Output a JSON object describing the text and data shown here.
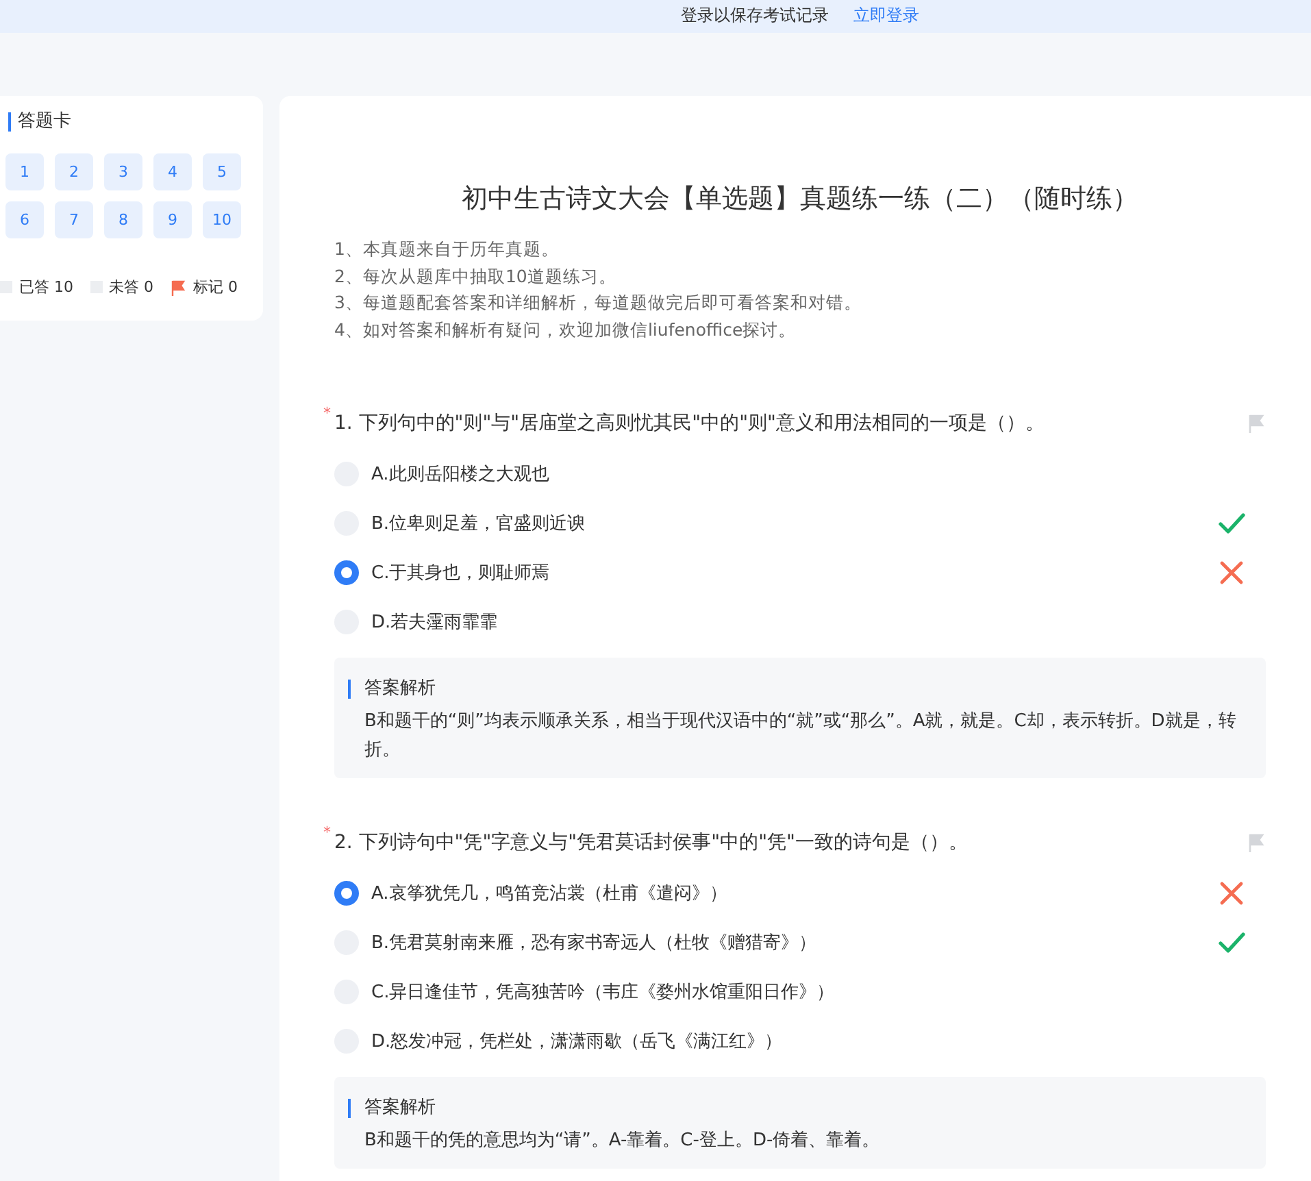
{
  "top_bar": {
    "message": "登录以保存考试记录",
    "login_link": "立即登录"
  },
  "answer_card": {
    "title": "答题卡",
    "numbers": [
      {
        "label": "1",
        "answered": true
      },
      {
        "label": "2",
        "answered": true
      },
      {
        "label": "3",
        "answered": true
      },
      {
        "label": "4",
        "answered": true
      },
      {
        "label": "5",
        "answered": true
      },
      {
        "label": "6",
        "answered": true
      },
      {
        "label": "7",
        "answered": true
      },
      {
        "label": "8",
        "answered": true
      },
      {
        "label": "9",
        "answered": true
      },
      {
        "label": "10",
        "answered": true
      }
    ],
    "legend": [
      {
        "kind": "answered",
        "label": "已答 10"
      },
      {
        "kind": "unanswered",
        "label": "未答 0"
      },
      {
        "kind": "flagged",
        "label": "标记 0"
      }
    ]
  },
  "exam": {
    "title": "初中生古诗文大会【单选题】真题练一练（二）（随时练）",
    "notes": [
      "1、本真题来自于历年真题。",
      "2、每次从题库中抽取10道题练习。",
      "3、每道题配套答案和详细解析，每道题做完后即可看答案和对错。",
      "4、如对答案和解析有疑问，欢迎加微信liufenoffice探讨。"
    ],
    "questions": [
      {
        "required_mark": "*",
        "text": "1. 下列句中的\"则\"与\"居庙堂之高则忧其民\"中的\"则\"意义和用法相同的一项是（）。",
        "flagged": false,
        "options": [
          {
            "text": "A.此则岳阳楼之大观也",
            "selected": false,
            "is_answer": false
          },
          {
            "text": "B.位卑则足羞，官盛则近谀",
            "selected": false,
            "is_answer": true
          },
          {
            "text": "C.于其身也，则耻师焉",
            "selected": true,
            "is_answer": false
          },
          {
            "text": "D.若夫霪雨霏霏",
            "selected": false,
            "is_answer": false
          }
        ],
        "analysis_title": "答案解析",
        "analysis": "B和题干的“则”均表示顺承关系，相当于现代汉语中的“就”或“那么”。A就，就是。C却，表示转折。D就是，转折。"
      },
      {
        "required_mark": "*",
        "text": "2. 下列诗句中\"凭\"字意义与\"凭君莫话封侯事\"中的\"凭\"一致的诗句是（）。",
        "flagged": false,
        "options": [
          {
            "text": "A.哀筝犹凭几，鸣笛竞沾裳（杜甫《遣闷》）",
            "selected": true,
            "is_answer": false
          },
          {
            "text": "B.凭君莫射南来雁，恐有家书寄远人（杜牧《赠猎寄》）",
            "selected": false,
            "is_answer": true
          },
          {
            "text": "C.异日逢佳节，凭高独苦吟（韦庄《婺州水馆重阳日作》）",
            "selected": false,
            "is_answer": false
          },
          {
            "text": "D.怒发冲冠，凭栏处，潇潇雨歇（岳飞《满江红》）",
            "selected": false,
            "is_answer": false
          }
        ],
        "analysis_title": "答案解析",
        "analysis": "B和题干的凭的意思均为“请”。A-靠着。C-登上。D-倚着、靠着。"
      }
    ]
  }
}
